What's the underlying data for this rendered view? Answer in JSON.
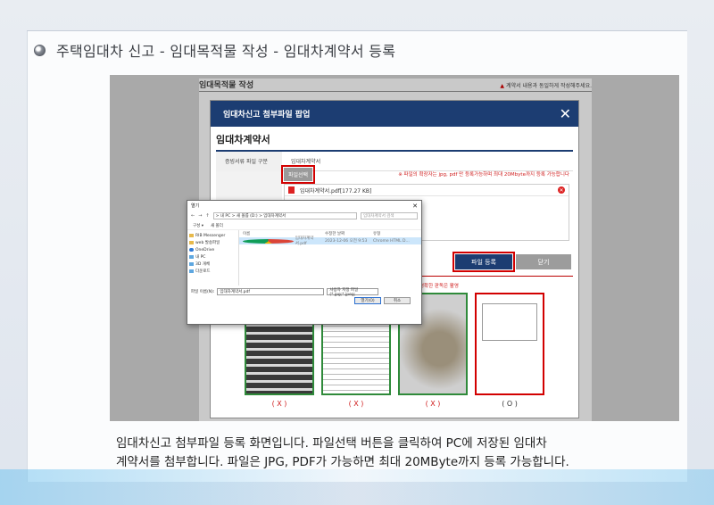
{
  "slide": {
    "title": "주택임대차 신고 - 임대목적물 작성 - 임대차계약서 등록",
    "caption_line1": "임대차신고 첨부파일 등록 화면입니다. 파일선택 버튼을 클릭하여 PC에 저장된 임대차",
    "caption_line2": "계약서를 첨부합니다. 파일은 JPG, PDF가 가능하면 최대 20MByte까지 등록 가능합니다."
  },
  "background_page": {
    "title": "임대목적물 작성",
    "warning": "계약서 내용과 동일하게 작성해주세요."
  },
  "modal": {
    "header_title": "임대차신고 첨부파일 팝업",
    "close_glyph": "✕",
    "section_title": "임대차계약서",
    "tab_left": "증빙서류 파일 구분",
    "tab_right": "임대차계약서",
    "file_button": "파일선택",
    "notice": "※ 파일의 확장자는 jpg, pdf 만 등록가능하며 최대 20Mbyte까지 등록 가능합니다",
    "attached_file": "임대차계약서.pdf[177.27 KB]",
    "register_button": "파일 등록",
    "close_button": "닫기",
    "example_note": "명확한 판독은 활영",
    "marks": [
      "( X )",
      "( X )",
      "( X )",
      "( O )"
    ]
  },
  "dialog": {
    "title": "열기",
    "path": "> 내 PC > 새 볼륨 (D:) > 임대차계약서",
    "search_placeholder": "임대차계약서 검색",
    "toolbar_left": "구성 ▾",
    "toolbar_new": "새 폴더",
    "sidebar": [
      "RIB Messenger",
      "web 발송파일",
      "OneDrive",
      "내 PC",
      "3D 개체",
      "다운로드"
    ],
    "col_name": "이름",
    "col_date": "수정한 날짜",
    "col_type": "유형",
    "file": {
      "name": "임대차계약서.pdf",
      "date": "2023-12-06 오전 9:53",
      "type": "Chrome HTML D..."
    },
    "filename_label": "파일 이름(N):",
    "filename_value": "임대차계약서.pdf",
    "filetype": "사용자 지정 파일 (*.jpg;*.jpeg;",
    "open_button": "열기(O)",
    "cancel_button": "취소"
  }
}
